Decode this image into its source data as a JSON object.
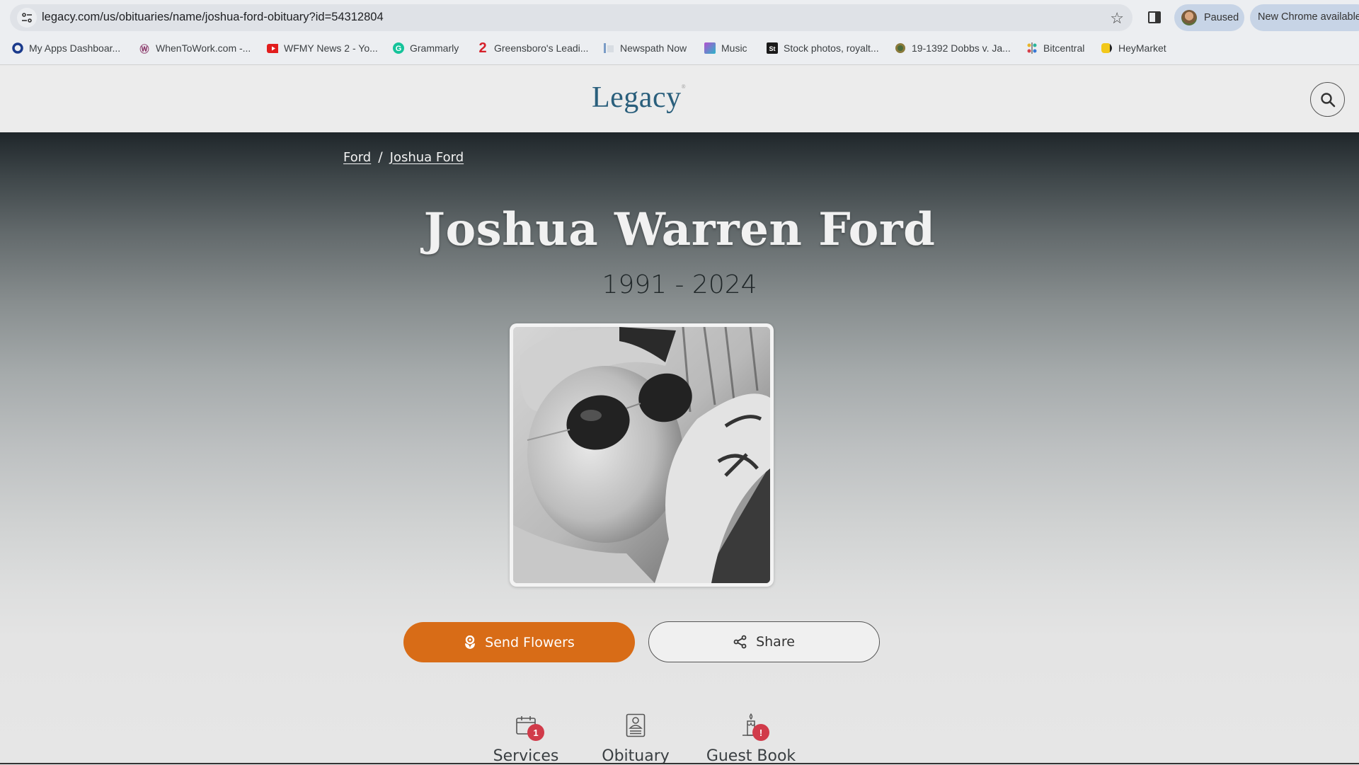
{
  "browser": {
    "url": "legacy.com/us/obituaries/name/joshua-ford-obituary?id=54312804",
    "profile_label": "Paused",
    "update_label": "New Chrome available",
    "bookmarks": [
      {
        "label": "My Apps Dashboar...",
        "icon": "my-apps-icon"
      },
      {
        "label": "WhenToWork.com -...",
        "icon": "whentowork-icon"
      },
      {
        "label": "WFMY News 2 - Yo...",
        "icon": "youtube-icon"
      },
      {
        "label": "Grammarly",
        "icon": "grammarly-icon"
      },
      {
        "label": "Greensboro's Leadi...",
        "icon": "greensboro-icon"
      },
      {
        "label": "Newspath Now",
        "icon": "newspath-icon"
      },
      {
        "label": "Music",
        "icon": "music-icon"
      },
      {
        "label": "Stock photos, royalt...",
        "icon": "stock-photos-icon"
      },
      {
        "label": "19-1392 Dobbs v. Ja...",
        "icon": "seal-icon"
      },
      {
        "label": "Bitcentral",
        "icon": "bitcentral-icon"
      },
      {
        "label": "HeyMarket",
        "icon": "heymarket-icon"
      }
    ]
  },
  "site": {
    "logo": "Legacy",
    "logo_mark": "®"
  },
  "breadcrumb": {
    "items": [
      "Ford",
      "Joshua Ford"
    ],
    "separator": "/"
  },
  "obituary": {
    "name": "Joshua Warren Ford",
    "dates": "1991 - 2024",
    "photo_alt": "Black and white photo of man in cap and aviator sunglasses"
  },
  "actions": {
    "send_flowers": "Send Flowers",
    "share": "Share"
  },
  "tabs": [
    {
      "label": "Services",
      "badge": "1"
    },
    {
      "label": "Obituary",
      "badge": ""
    },
    {
      "label": "Guest Book",
      "badge": "!"
    }
  ],
  "colors": {
    "accent": "#d86c17",
    "brand": "#2a5f7c",
    "badge": "#d13b4a"
  }
}
